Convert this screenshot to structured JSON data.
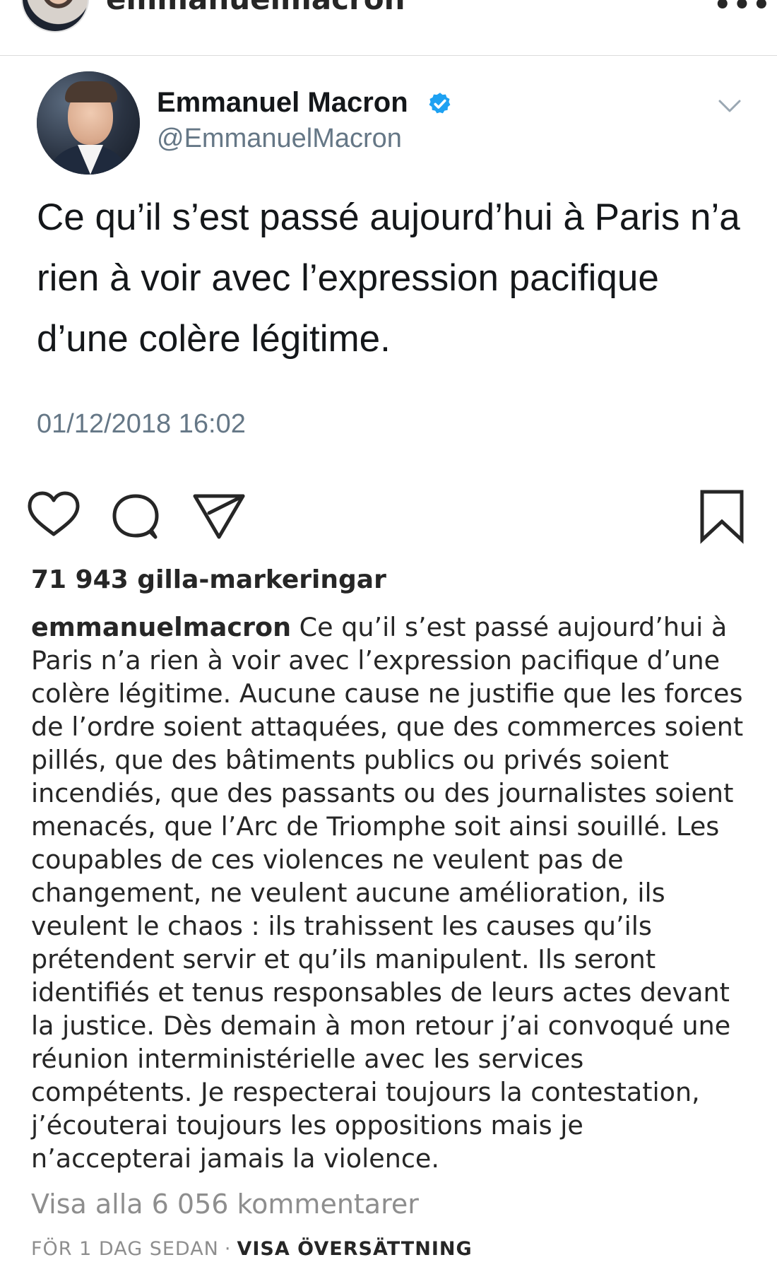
{
  "post": {
    "username": "emmanuelmacron",
    "more_icon": "•••"
  },
  "tweet": {
    "name": "Emmanuel Macron",
    "handle": "@EmmanuelMacron",
    "text": "Ce qu’il s’est passé aujourd’hui à Paris n’a rien à voir avec l’expression pacifique d’une colère légitime.",
    "date": "01/12/2018 16:02",
    "verified_color": "#1da1f2"
  },
  "actions": {
    "icons": [
      "heart-icon",
      "comment-icon",
      "share-icon",
      "bookmark-icon"
    ]
  },
  "likes": "71 943 gilla-markeringar",
  "caption": {
    "username": "emmanuelmacron",
    "text": "Ce qu’il s’est passé aujourd’hui à Paris n’a rien à voir avec l’expression pacifique d’une colère légitime. Aucune cause ne justifie que les forces de l’ordre soient attaquées, que des commerces soient pillés, que des bâtiments publics ou privés soient incendiés, que des passants ou des journalistes soient menacés, que l’Arc de Triomphe soit ainsi souillé. Les coupables de ces violences ne veulent pas de changement, ne veulent aucune amélioration, ils veulent le chaos : ils trahissent les causes qu’ils prétendent servir et qu’ils manipulent. Ils seront identifiés et tenus responsables de leurs actes devant la justice. Dès demain à mon retour j’ai convoqué une réunion interministérielle avec les services compétents. Je respecterai toujours la contestation, j’écouterai toujours les oppositions mais je n’accepterai jamais la violence."
  },
  "view_comments": "Visa alla 6 056 kommentarer",
  "meta": {
    "time": "FÖR 1 DAG SEDAN",
    "separator": "·",
    "translate": "VISA ÖVERSÄTTNING"
  }
}
